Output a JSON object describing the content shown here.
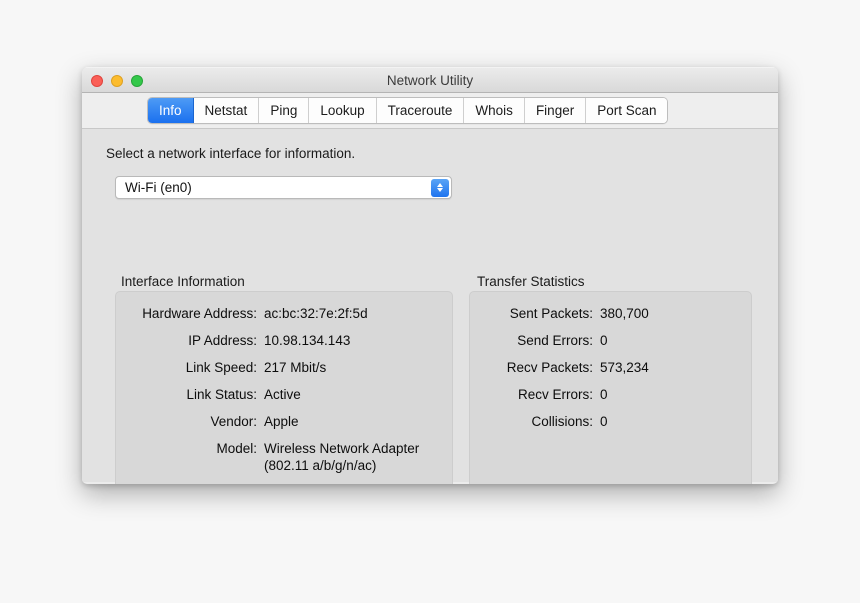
{
  "window": {
    "title": "Network Utility",
    "traffic_lights": [
      "close",
      "minimize",
      "maximize"
    ]
  },
  "tabs": [
    {
      "label": "Info",
      "active": true
    },
    {
      "label": "Netstat",
      "active": false
    },
    {
      "label": "Ping",
      "active": false
    },
    {
      "label": "Lookup",
      "active": false
    },
    {
      "label": "Traceroute",
      "active": false
    },
    {
      "label": "Whois",
      "active": false
    },
    {
      "label": "Finger",
      "active": false
    },
    {
      "label": "Port Scan",
      "active": false
    }
  ],
  "main": {
    "prompt": "Select a network interface for information.",
    "interface_select": {
      "value": "Wi-Fi (en0)"
    },
    "interface_information": {
      "title": "Interface Information",
      "rows": [
        {
          "label": "Hardware Address:",
          "value": "ac:bc:32:7e:2f:5d"
        },
        {
          "label": "IP Address:",
          "value": "10.98.134.143"
        },
        {
          "label": "Link Speed:",
          "value": "217 Mbit/s"
        },
        {
          "label": "Link Status:",
          "value": "Active"
        },
        {
          "label": "Vendor:",
          "value": "Apple"
        },
        {
          "label": "Model:",
          "value": "Wireless Network Adapter\n(802.11 a/b/g/n/ac)"
        }
      ]
    },
    "transfer_statistics": {
      "title": "Transfer Statistics",
      "rows": [
        {
          "label": "Sent Packets:",
          "value": "380,700"
        },
        {
          "label": "Send Errors:",
          "value": "0"
        },
        {
          "label": "Recv Packets:",
          "value": "573,234"
        },
        {
          "label": "Recv Errors:",
          "value": "0"
        },
        {
          "label": "Collisions:",
          "value": "0"
        }
      ]
    }
  },
  "colors": {
    "accent_blue": "#1a70ef",
    "window_chrome": "#ececec",
    "content_background": "#e2e2e2",
    "panel_background": "#d8d8d8"
  }
}
